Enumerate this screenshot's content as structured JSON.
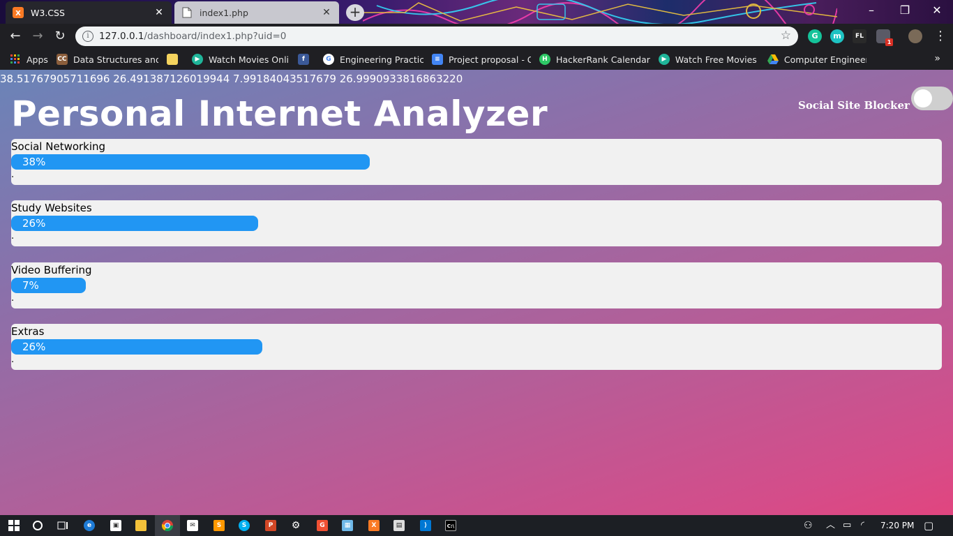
{
  "browser": {
    "tabs": [
      {
        "title": "W3.CSS",
        "active": true,
        "icon": "xampp-icon"
      },
      {
        "title": "index1.php",
        "active": false,
        "icon": "document-icon"
      }
    ],
    "url_host": "127.0.0.1",
    "url_path": "/dashboard/index1.php?uid=0",
    "extension_badge": "1",
    "bookmarks": [
      {
        "label": "Apps",
        "icon": "apps-grid-icon",
        "color": "#4285f4"
      },
      {
        "label": "Data Structures and A",
        "icon": "cc-icon",
        "color": "#8b5e3c"
      },
      {
        "label": "",
        "icon": "folder-icon",
        "color": "#f4c542"
      },
      {
        "label": "Watch Movies Online",
        "icon": "play-icon",
        "color": "#1fb59a"
      },
      {
        "label": "",
        "icon": "facebook-icon",
        "color": "#3b5998"
      },
      {
        "label": "Engineering Practicum",
        "icon": "google-icon",
        "color": "#ffffff"
      },
      {
        "label": "Project proposal - Go",
        "icon": "docs-icon",
        "color": "#4285f4"
      },
      {
        "label": "HackerRank Calendar",
        "icon": "hackerrank-icon",
        "color": "#2ec866"
      },
      {
        "label": "Watch Free Movies O",
        "icon": "play-icon",
        "color": "#1fb59a"
      },
      {
        "label": "Computer Engineering",
        "icon": "drive-icon",
        "color": "#fbbc04"
      }
    ],
    "more_bookmarks": "»"
  },
  "page": {
    "raw_values": "38.51767905711696 26.491387126019944 7.99184043517679 26.9990933816863220",
    "title": "Personal Internet Analyzer",
    "blocker_label": "Social Site Blocker",
    "blocker_enabled": false,
    "categories": [
      {
        "label": "Social Networking",
        "percent_label": "38%",
        "percent": 38.5,
        "footer": "."
      },
      {
        "label": "Study Websites",
        "percent_label": "26%",
        "percent": 26.5,
        "footer": "."
      },
      {
        "label": "Video Buffering",
        "percent_label": "7%",
        "percent": 8.0,
        "footer": "."
      },
      {
        "label": "Extras",
        "percent_label": "26%",
        "percent": 27.0,
        "footer": "."
      }
    ],
    "colors": {
      "bar": "#2196f3",
      "card": "#f1f1f1"
    }
  },
  "taskbar": {
    "time": "7:20 PM",
    "apps": [
      "windows-start-icon",
      "search-icon",
      "task-view-icon",
      "edge-icon",
      "store-icon",
      "file-explorer-icon",
      "chrome-icon",
      "mail-icon",
      "sublime-icon",
      "skype-icon",
      "powerpoint-icon",
      "settings-icon",
      "git-icon",
      "vmware-icon",
      "xampp-icon",
      "calculator-icon",
      "vscode-icon",
      "terminal-icon"
    ]
  }
}
